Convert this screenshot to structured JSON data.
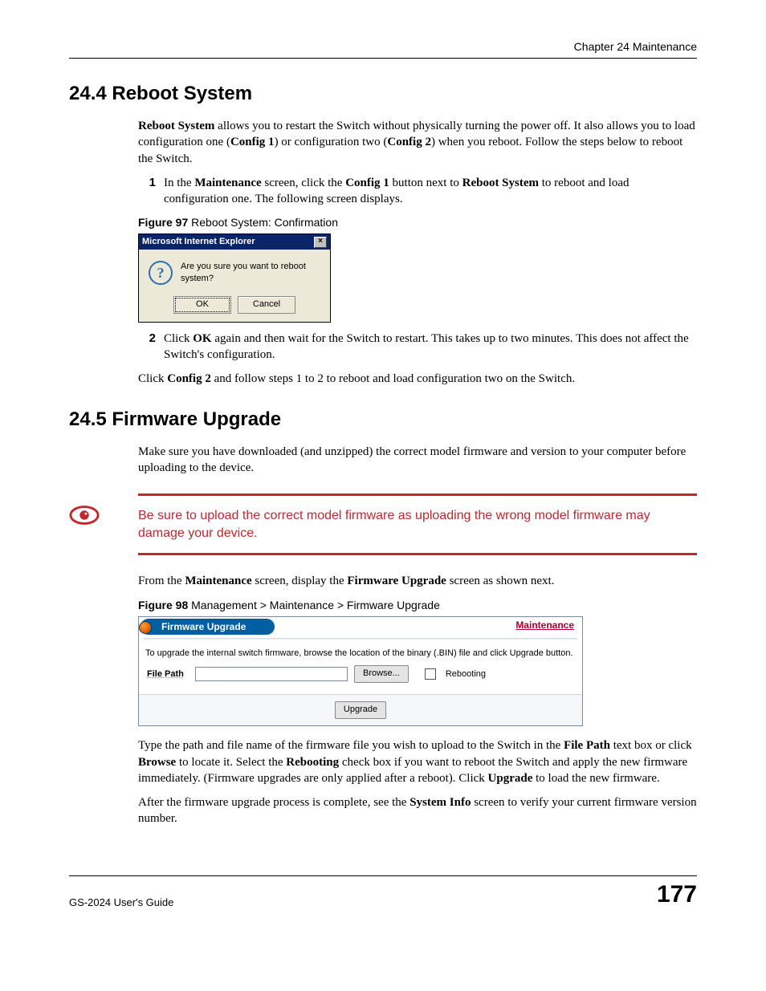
{
  "header": {
    "chapter": "Chapter 24 Maintenance"
  },
  "s244": {
    "title": "24.4  Reboot System",
    "p1_pre": "Reboot System",
    "p1_rest": " allows you to restart the Switch without physically turning the power off. It also allows you to load configuration one (",
    "cfg1": "Config 1",
    "p1_mid": ") or configuration two (",
    "cfg2": "Config 2",
    "p1_end": ") when you reboot. Follow the steps below to reboot the Switch.",
    "step1_num": "1",
    "step1_a": "In the ",
    "step1_maint": "Maintenance",
    "step1_b": " screen, click the ",
    "step1_cfg1": "Config 1",
    "step1_c": " button next to ",
    "step1_rs": "Reboot System",
    "step1_d": " to reboot and load configuration one. The following screen displays.",
    "fig97_label": "Figure 97",
    "fig97_cap": "   Reboot System: Confirmation",
    "dialog": {
      "title": "Microsoft Internet Explorer",
      "close": "×",
      "msg": "Are you sure you want to reboot system?",
      "ok": "OK",
      "cancel": "Cancel"
    },
    "step2_num": "2",
    "step2_a": "Click ",
    "step2_ok": "OK",
    "step2_b": " again and then wait for the Switch to restart. This takes up to two minutes. This does not affect the Switch's configuration.",
    "p2_a": "Click ",
    "p2_cfg2": "Config 2",
    "p2_b": " and follow steps 1 to 2 to reboot and load configuration two on the Switch."
  },
  "s245": {
    "title": "24.5  Firmware Upgrade",
    "p1": "Make sure you have downloaded (and unzipped) the correct model firmware and version to your computer before uploading to the device.",
    "warn": "Be sure to upload the correct model firmware as uploading the wrong model firmware may damage your device.",
    "p2_a": "From the ",
    "p2_maint": "Maintenance",
    "p2_b": " screen, display the ",
    "p2_fw": "Firmware Upgrade",
    "p2_c": " screen as shown next.",
    "fig98_label": "Figure 98",
    "fig98_cap": "   Management > Maintenance > Firmware Upgrade",
    "panel": {
      "tab": "Firmware Upgrade",
      "link": "Maintenance",
      "instr": "To upgrade the internal switch firmware, browse the location of the binary (.BIN) file and click Upgrade button.",
      "file_label": "File Path",
      "browse": "Browse...",
      "rebooting": "Rebooting",
      "upgrade": "Upgrade"
    },
    "p3_a": "Type the path and file name of the firmware file you wish to upload to the Switch in the ",
    "p3_fp": "File Path",
    "p3_b": " text box or click ",
    "p3_browse": "Browse",
    "p3_c": " to locate it. Select the ",
    "p3_reboot": "Rebooting",
    "p3_d": " check box if you want to reboot the Switch and apply the new firmware immediately. (Firmware upgrades are only applied after a reboot). Click ",
    "p3_up": "Upgrade",
    "p3_e": " to load the new firmware.",
    "p4_a": "After the firmware upgrade process is complete, see the ",
    "p4_si": "System Info",
    "p4_b": " screen to verify your current firmware version number."
  },
  "footer": {
    "guide": "GS-2024 User's Guide",
    "page": "177"
  }
}
